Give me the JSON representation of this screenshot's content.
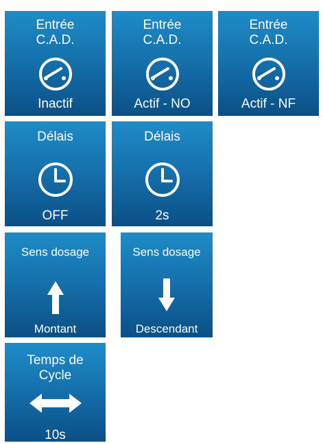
{
  "row1": [
    {
      "title": "Entrée\nC.A.D.",
      "status": "Inactif",
      "icon": "switch-icon"
    },
    {
      "title": "Entrée\nC.A.D.",
      "status": "Actif - NO",
      "icon": "switch-icon"
    },
    {
      "title": "Entrée\nC.A.D.",
      "status": "Actif - NF",
      "icon": "switch-icon"
    }
  ],
  "row2": [
    {
      "title": "Délais",
      "status": "OFF",
      "icon": "clock-icon"
    },
    {
      "title": "Délais",
      "status": "2s",
      "icon": "clock-icon"
    }
  ],
  "row3": [
    {
      "title": "Sens dosage",
      "status": "Montant",
      "icon": "arrow-up-icon"
    },
    {
      "title": "Sens dosage",
      "status": "Descendant",
      "icon": "arrow-down-icon"
    }
  ],
  "row4": [
    {
      "title": "Temps de\nCycle",
      "status": "10s",
      "icon": "arrow-left-right-icon"
    }
  ],
  "colors": {
    "tile_top": "#1e8cc8",
    "tile_bottom": "#0b4f86",
    "text": "#ffffff"
  }
}
